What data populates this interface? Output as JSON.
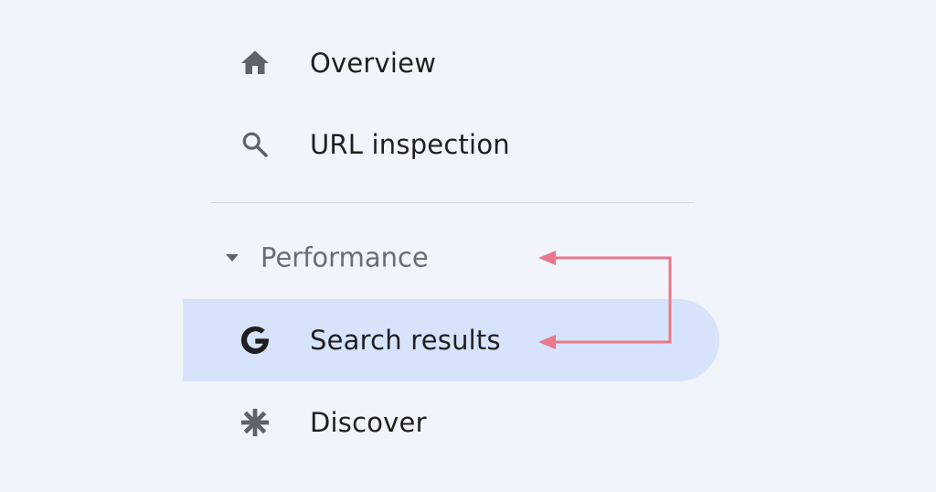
{
  "nav": {
    "overview": {
      "label": "Overview",
      "icon": "home-icon"
    },
    "url_inspection": {
      "label": "URL inspection",
      "icon": "search-icon"
    },
    "performance": {
      "label": "Performance",
      "icon": "caret-down-icon",
      "expanded": true
    },
    "search_results": {
      "label": "Search results",
      "icon": "google-g-icon",
      "selected": true
    },
    "discover": {
      "label": "Discover",
      "icon": "asterisk-icon"
    }
  },
  "colors": {
    "background": "#f1f4fb",
    "selected_background": "#d6e3fb",
    "icon": "#5f6368",
    "text": "#1f1f1f",
    "section_text": "#6b6d70",
    "annotation_arrow": "#e9788a"
  }
}
